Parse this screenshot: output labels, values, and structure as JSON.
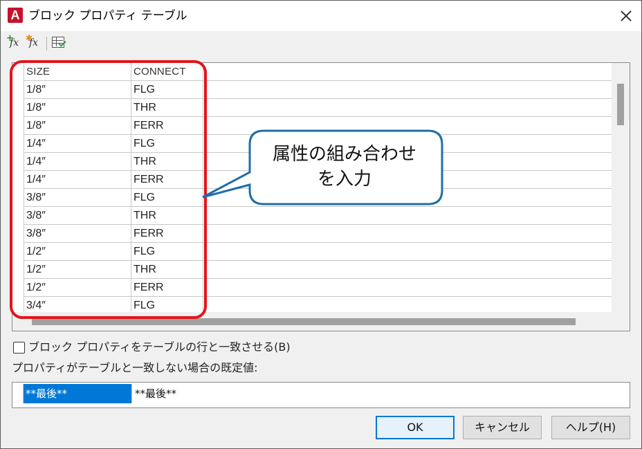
{
  "window": {
    "title": "ブロック プロパティ テーブル",
    "app_icon_letter": "A"
  },
  "toolbar": {
    "icons": [
      "add-property-icon",
      "add-user-parameter-icon",
      "audit-table-icon"
    ],
    "fx_glyph": "fx"
  },
  "table": {
    "columns": [
      "SIZE",
      "CONNECT"
    ],
    "rows": [
      [
        "1/8″",
        "FLG"
      ],
      [
        "1/8″",
        "THR"
      ],
      [
        "1/8″",
        "FERR"
      ],
      [
        "1/4″",
        "FLG"
      ],
      [
        "1/4″",
        "THR"
      ],
      [
        "1/4″",
        "FERR"
      ],
      [
        "3/8″",
        "FLG"
      ],
      [
        "3/8″",
        "THR"
      ],
      [
        "3/8″",
        "FERR"
      ],
      [
        "1/2″",
        "FLG"
      ],
      [
        "1/2″",
        "THR"
      ],
      [
        "1/2″",
        "FERR"
      ],
      [
        "3/4″",
        "FLG"
      ]
    ]
  },
  "annotation": {
    "line1": "属性の組み合わせ",
    "line2": "を入力",
    "highlight_color": "#e3151a",
    "callout_border_color": "#1f6ea8"
  },
  "options": {
    "sync_checkbox_label": "ブロック プロパティをテーブルの行と一致させる(B)",
    "sync_checked": false,
    "default_caption": "プロパティがテーブルと一致しない場合の既定値:",
    "default_values": [
      "**最後**",
      "**最後**"
    ]
  },
  "buttons": {
    "ok": "OK",
    "cancel": "キャンセル",
    "help": "ヘルプ(H)"
  }
}
